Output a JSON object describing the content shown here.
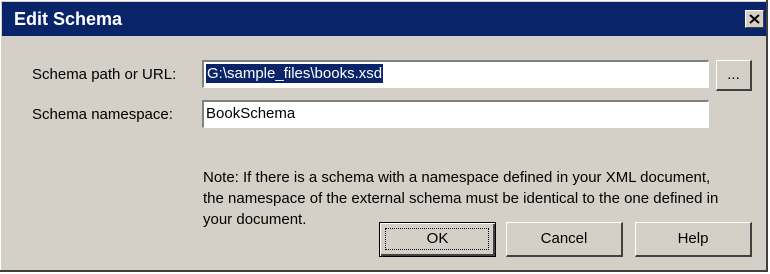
{
  "window": {
    "title": "Edit Schema",
    "close_icon": "close-icon"
  },
  "form": {
    "path_label": "Schema path or URL:",
    "path_value": "G:\\sample_files\\books.xsd",
    "browse_label": "...",
    "namespace_label": "Schema namespace:",
    "namespace_value": "BookSchema"
  },
  "note": "Note: If there is a schema with a namespace defined in your XML document, the namespace of the external schema must be identical to the one defined in your document.",
  "buttons": {
    "ok": "OK",
    "cancel": "Cancel",
    "help": "Help"
  },
  "colors": {
    "titlebar": "#0a246a",
    "dialog_face": "#d4d0c8",
    "selection": "#0a246a"
  }
}
